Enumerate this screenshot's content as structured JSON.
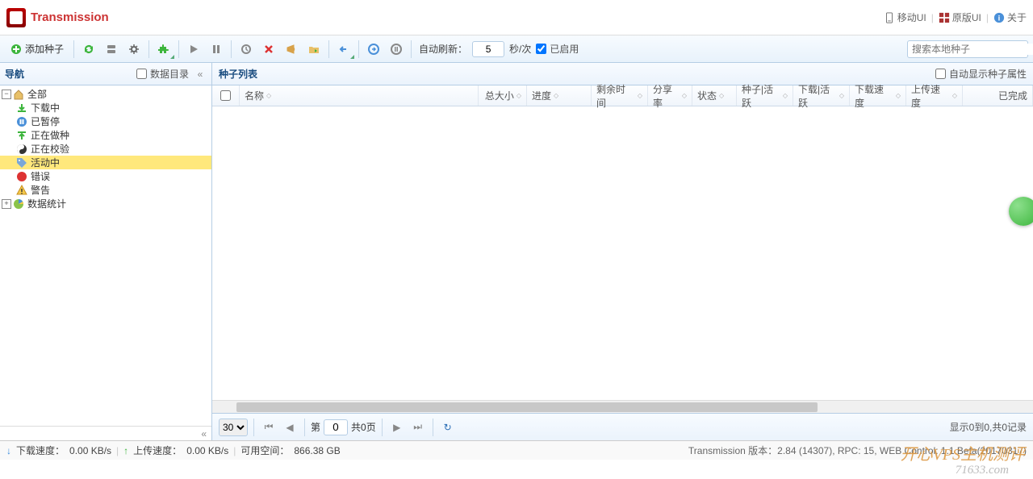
{
  "brand": "Transmission",
  "header_links": {
    "mobile": "移动UI",
    "original": "原版UI",
    "about": "关于"
  },
  "toolbar": {
    "add_torrent": "添加种子",
    "auto_refresh_label": "自动刷新：",
    "auto_refresh_value": "5",
    "auto_refresh_unit": "秒/次",
    "enabled": "已启用"
  },
  "search": {
    "placeholder": "搜索本地种子"
  },
  "nav_panel": {
    "title": "导航",
    "data_dir": "数据目录"
  },
  "list_panel": {
    "title": "种子列表",
    "auto_show": "自动显示种子属性"
  },
  "tree": {
    "all": "全部",
    "downloading": "下载中",
    "paused": "已暂停",
    "seeding": "正在做种",
    "verifying": "正在校验",
    "active": "活动中",
    "error": "错误",
    "warning": "警告",
    "stats": "数据统计"
  },
  "columns": {
    "name": "名称",
    "size": "总大小",
    "progress": "进度",
    "remaining": "剩余时间",
    "ratio": "分享率",
    "status": "状态",
    "seeds": "种子|活跃",
    "peers": "下载|活跃",
    "dl_speed": "下载速度",
    "ul_speed": "上传速度",
    "done": "已完成"
  },
  "pager": {
    "page_size": "30",
    "page_label_pre": "第",
    "page_value": "0",
    "page_label_post": "共0页",
    "summary": "显示0到0,共0记录"
  },
  "status": {
    "dl_label": "下载速度：",
    "dl_value": "0.00 KB/s",
    "ul_label": "上传速度：",
    "ul_value": "0.00 KB/s",
    "space_label": "可用空间：",
    "space_value": "866.38 GB",
    "version": "Transmission 版本：2.84 (14307), RPC: 15, WEB Control: 1.1 Beta(20170317)"
  },
  "watermark1": "开心VPS主机测评",
  "watermark2": "71633.com"
}
